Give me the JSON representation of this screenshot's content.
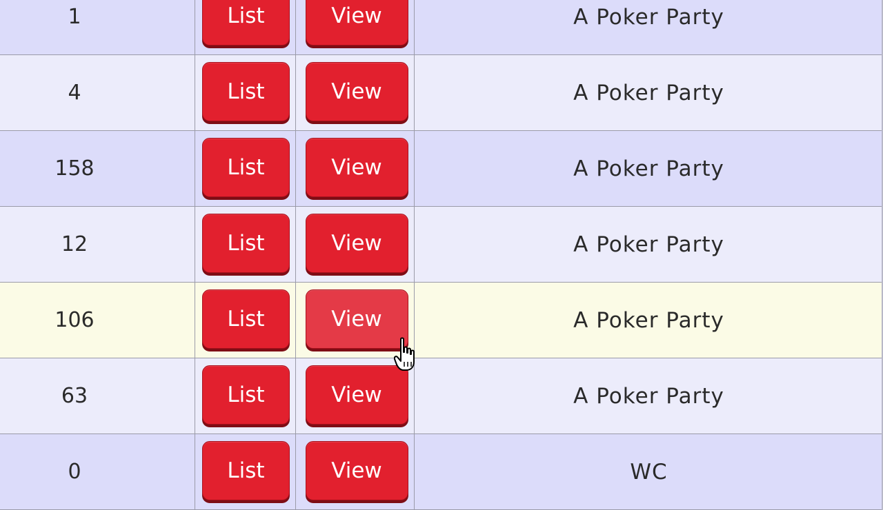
{
  "table": {
    "rows": [
      {
        "count": "1",
        "list_label": "List",
        "view_label": "View",
        "name": "A Poker Party",
        "style": "odd"
      },
      {
        "count": "4",
        "list_label": "List",
        "view_label": "View",
        "name": "A Poker Party",
        "style": "even"
      },
      {
        "count": "158",
        "list_label": "List",
        "view_label": "View",
        "name": "A Poker Party",
        "style": "odd"
      },
      {
        "count": "12",
        "list_label": "List",
        "view_label": "View",
        "name": "A Poker Party",
        "style": "even"
      },
      {
        "count": "106",
        "list_label": "List",
        "view_label": "View",
        "name": "A Poker Party",
        "style": "highlight"
      },
      {
        "count": "63",
        "list_label": "List",
        "view_label": "View",
        "name": "A Poker Party",
        "style": "even"
      },
      {
        "count": "0",
        "list_label": "List",
        "view_label": "View",
        "name": "WC",
        "style": "odd"
      }
    ]
  },
  "colors": {
    "button_red": "#e2202e",
    "row_odd": "#dcdcfa",
    "row_even": "#ececfb",
    "row_highlight": "#fbfbe6"
  },
  "cursor": {
    "icon": "hand-pointer-icon"
  }
}
